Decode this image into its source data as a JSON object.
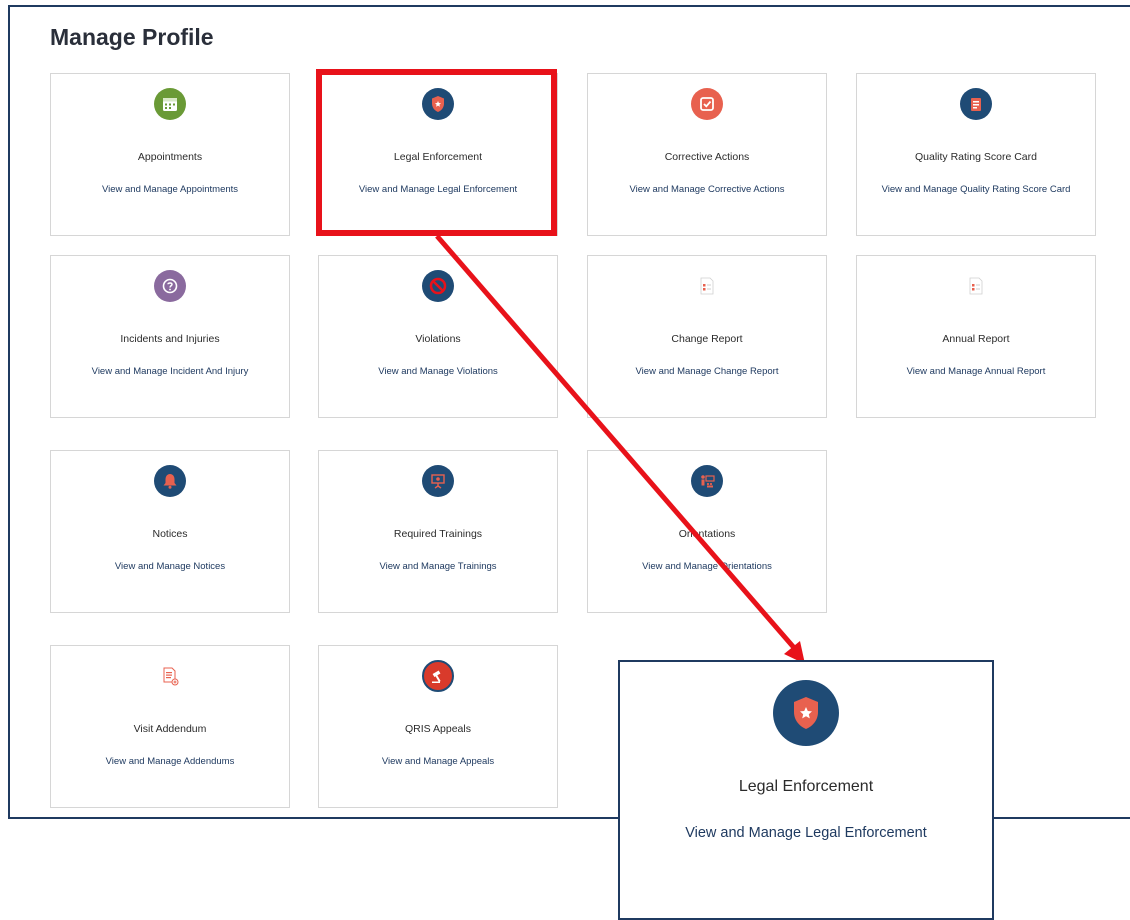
{
  "page": {
    "title": "Manage Profile"
  },
  "cards": [
    {
      "title": "Appointments",
      "desc": "View and Manage Appointments",
      "icon": "calendar-icon",
      "color": "#6a9a36"
    },
    {
      "title": "Legal Enforcement",
      "desc": "View and Manage Legal Enforcement",
      "icon": "shield-icon",
      "color": "#1f4b75"
    },
    {
      "title": "Corrective Actions",
      "desc": "View and Manage Corrective Actions",
      "icon": "checkbox-icon",
      "color": "#e8614f"
    },
    {
      "title": "Quality Rating Score Card",
      "desc": "View and Manage Quality Rating Score Card",
      "icon": "score-card-icon",
      "color": "#1f4b75"
    },
    {
      "title": "Incidents and Injuries",
      "desc": "View and Manage Incident And Injury",
      "icon": "question-icon",
      "color": "#8a6a9e"
    },
    {
      "title": "Violations",
      "desc": "View and Manage Violations",
      "icon": "prohibited-icon",
      "color": "#1f4b75"
    },
    {
      "title": "Change Report",
      "desc": "View and Manage Change Report",
      "icon": "report-icon",
      "color": "#e8614f"
    },
    {
      "title": "Annual Report",
      "desc": "View and Manage Annual Report",
      "icon": "report-icon",
      "color": "#e8614f"
    },
    {
      "title": "Notices",
      "desc": "View and Manage Notices",
      "icon": "bell-icon",
      "color": "#1f4b75"
    },
    {
      "title": "Required Trainings",
      "desc": "View and Manage Trainings",
      "icon": "presentation-icon",
      "color": "#1f4b75"
    },
    {
      "title": "Orientations",
      "desc": "View and Manage Orientations",
      "icon": "classroom-icon",
      "color": "#1f4b75"
    },
    {
      "title": "Visit Addendum",
      "desc": "View and Manage Addendums",
      "icon": "document-add-icon",
      "color": "#e8614f"
    },
    {
      "title": "QRIS Appeals",
      "desc": "View and Manage Appeals",
      "icon": "gavel-icon",
      "color": "#d93a2b"
    }
  ],
  "zoom": {
    "title": "Legal Enforcement",
    "desc": "View and Manage Legal Enforcement",
    "icon": "shield-icon"
  },
  "annotation": {
    "highlight_color": "#e8121a"
  }
}
